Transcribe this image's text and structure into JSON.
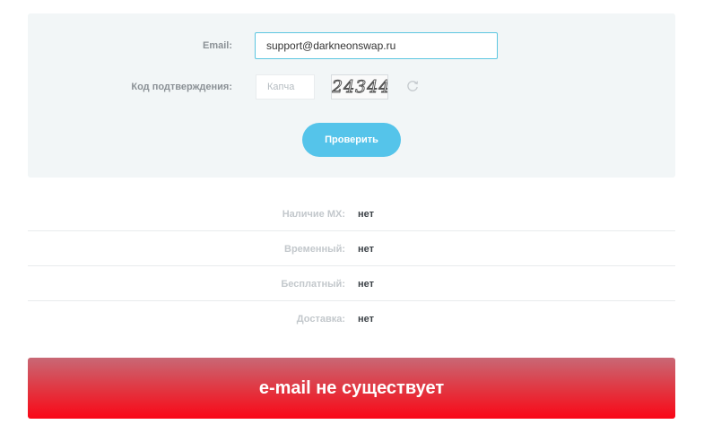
{
  "form": {
    "email_label": "Email:",
    "email_value": "support@darkneonswap.ru",
    "captcha_label": "Код подтверждения:",
    "captcha_placeholder": "Капча",
    "captcha_image_text": "24344",
    "check_button_label": "Проверить"
  },
  "results": [
    {
      "label": "Наличие MX:",
      "value": "нет"
    },
    {
      "label": "Временный:",
      "value": "нет"
    },
    {
      "label": "Бесплатный:",
      "value": "нет"
    },
    {
      "label": "Доставка:",
      "value": "нет"
    }
  ],
  "status": {
    "message": "e-mail не существует",
    "color_top": "#c86875",
    "color_bottom": "#fa0717"
  },
  "icons": {
    "refresh": "refresh-icon"
  }
}
